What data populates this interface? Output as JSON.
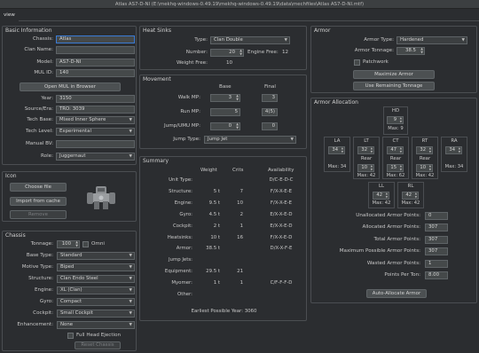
{
  "window": {
    "title": "Atlas AS7-D-NI (E:\\mekhq-windows-0.49.19\\mekhq-windows-0.49.19\\data\\mechfiles\\Atlas AS7-D-NI.mtf)"
  },
  "tabs": [
    {
      "label": "view"
    }
  ],
  "basic": {
    "title": "Basic Information",
    "chassis_label": "Chassis:",
    "chassis_value": "Atlas",
    "clan_name_label": "Clan Name:",
    "clan_name_value": "",
    "model_label": "Model:",
    "model_value": "AS7-D-NI",
    "mul_label": "MUL ID:",
    "mul_value": "140",
    "open_mul_button": "Open MUL in Browser",
    "year_label": "Year:",
    "year_value": "3150",
    "source_label": "Source/Era:",
    "source_value": "TRO: 3039",
    "techbase_label": "Tech Base:",
    "techbase_value": "Mixed Inner Sphere",
    "techlevel_label": "Tech Level:",
    "techlevel_value": "Experimental",
    "manual_bv_label": "Manual BV:",
    "manual_bv_value": "",
    "role_label": "Role:",
    "role_value": "Juggernaut"
  },
  "icon": {
    "title": "Icon",
    "choose_button": "Choose file",
    "import_button": "Import from cache",
    "remove_button": "Remove"
  },
  "chassis": {
    "title": "Chassis",
    "tonnage_label": "Tonnage:",
    "tonnage_value": "100",
    "omni_label": "Omni",
    "basetype_label": "Base Type:",
    "basetype_value": "Standard",
    "motive_label": "Motive Type:",
    "motive_value": "Biped",
    "structure_label": "Structure:",
    "structure_value": "Clan Endo Steel",
    "engine_label": "Engine:",
    "engine_value": "XL (Clan)",
    "gyro_label": "Gyro:",
    "gyro_value": "Compact",
    "cockpit_label": "Cockpit:",
    "cockpit_value": "Small Cockpit",
    "enhancement_label": "Enhancement:",
    "enhancement_value": "None",
    "full_head_label": "Full Head Ejection",
    "reset_button": "Reset Chassis"
  },
  "heatsinks": {
    "title": "Heat Sinks",
    "type_label": "Type:",
    "type_value": "Clan Double",
    "number_label": "Number:",
    "number_value": "20",
    "engine_free_label": "Engine Free:",
    "engine_free_value": "12",
    "weight_free_label": "Weight Free:",
    "weight_free_value": "10"
  },
  "movement": {
    "title": "Movement",
    "base_header": "Base",
    "final_header": "Final",
    "walk_label": "Walk MP:",
    "walk_base": "3",
    "walk_final": "3",
    "run_label": "Run MP:",
    "run_base": "5",
    "run_final": "4(5)",
    "jump_label": "Jump/UMU MP:",
    "jump_base": "0",
    "jump_final": "0",
    "jumptype_label": "Jump Type:",
    "jumptype_value": "Jump Jet"
  },
  "summary": {
    "title": "Summary",
    "headers": {
      "weight": "Weight",
      "crits": "Crits",
      "availability": "Availability"
    },
    "rows": [
      {
        "label": "Unit Type:",
        "weight": "",
        "crits": "",
        "avail": "D/C-E-D-C"
      },
      {
        "label": "Structure:",
        "weight": "5 t",
        "crits": "7",
        "avail": "F/X-X-E-E"
      },
      {
        "label": "Engine:",
        "weight": "9.5 t",
        "crits": "10",
        "avail": "F/X-X-E-E"
      },
      {
        "label": "Gyro:",
        "weight": "4.5 t",
        "crits": "2",
        "avail": "E/X-X-E-D"
      },
      {
        "label": "Cockpit:",
        "weight": "2 t",
        "crits": "1",
        "avail": "E/X-X-E-D"
      },
      {
        "label": "Heatsinks:",
        "weight": "10 t",
        "crits": "16",
        "avail": "F/X-X-E-D"
      },
      {
        "label": "Armor:",
        "weight": "38.5 t",
        "crits": "",
        "avail": "D/X-X-F-E"
      },
      {
        "label": "Jump Jets:",
        "weight": "",
        "crits": "",
        "avail": ""
      },
      {
        "label": "Equipment:",
        "weight": "29.5 t",
        "crits": "21",
        "avail": ""
      },
      {
        "label": "Myomer:",
        "weight": "1 t",
        "crits": "1",
        "avail": "C/F-F-F-D"
      },
      {
        "label": "Other:",
        "weight": "",
        "crits": "",
        "avail": ""
      }
    ],
    "earliest_year": "Earliest Possible Year: 3060"
  },
  "armor": {
    "title": "Armor",
    "type_label": "Armor Type:",
    "type_value": "Hardened",
    "tonnage_label": "Armor Tonnage:",
    "tonnage_value": "38.5",
    "patchwork_label": "Patchwork",
    "maximize_button": "Maximize Armor",
    "remaining_button": "Use Remaining Tonnage"
  },
  "allocation": {
    "title": "Armor Allocation",
    "hd": {
      "label": "HD",
      "value": "9",
      "max": "Max: 9"
    },
    "la": {
      "label": "LA",
      "value": "34",
      "max": "Max: 34"
    },
    "lt": {
      "label": "LT",
      "value": "32",
      "rear_label": "Rear",
      "rear": "10",
      "max": "Max: 42"
    },
    "ct": {
      "label": "CT",
      "value": "47",
      "rear_label": "Rear",
      "rear": "15",
      "max": "Max: 62"
    },
    "rt": {
      "label": "RT",
      "value": "32",
      "rear_label": "Rear",
      "rear": "10",
      "max": "Max: 42"
    },
    "ra": {
      "label": "RA",
      "value": "34",
      "max": "Max: 34"
    },
    "ll": {
      "label": "LL",
      "value": "42",
      "max": "Max: 42"
    },
    "rl": {
      "label": "RL",
      "value": "42",
      "max": "Max: 42"
    },
    "stats": [
      {
        "label": "Unallocated Armor Points:",
        "value": "0"
      },
      {
        "label": "Allocated Armor Points:",
        "value": "307"
      },
      {
        "label": "Total Armor Points:",
        "value": "307"
      },
      {
        "label": "Maximum Possible Armor Points:",
        "value": "307"
      },
      {
        "label": "Wasted Armor Points:",
        "value": "1"
      },
      {
        "label": "Points Per Ton:",
        "value": "8.00"
      }
    ],
    "auto_button": "Auto-Allocate Armor"
  }
}
